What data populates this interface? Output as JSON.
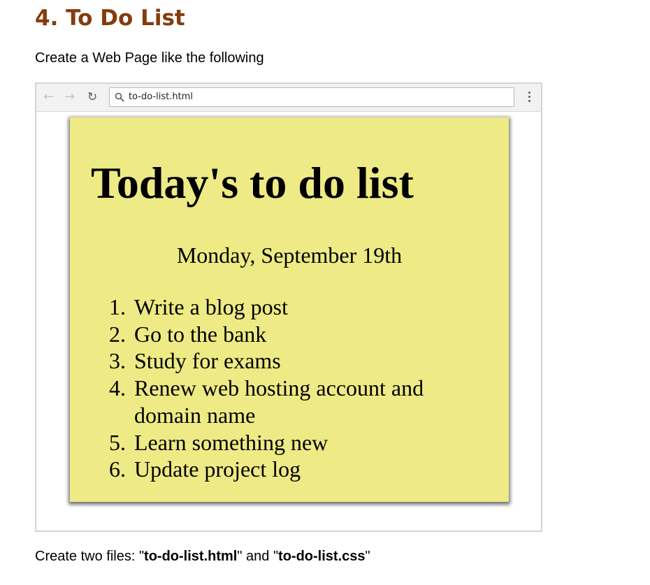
{
  "document": {
    "heading": "4. To Do List",
    "intro": "Create a Web Page like the following",
    "footer": {
      "prefix": "Create two files: \"",
      "file1": "to-do-list.html",
      "middle": "\" and \"",
      "file2": "to-do-list.css",
      "suffix": "\""
    }
  },
  "browser": {
    "address": "to-do-list.html",
    "icons": [
      "back-arrow-icon",
      "forward-arrow-icon",
      "reload-icon",
      "search-icon",
      "menu-dots-icon"
    ]
  },
  "page": {
    "background_color": "#eeea85",
    "title": "Today's to do list",
    "date": "Monday, September 19th",
    "items": [
      "Write a blog post",
      "Go to the bank",
      "Study for exams",
      "Renew web hosting account and domain name",
      "Learn something new",
      "Update project log"
    ]
  },
  "colors": {
    "heading": "#843c0c",
    "text": "#000000"
  }
}
